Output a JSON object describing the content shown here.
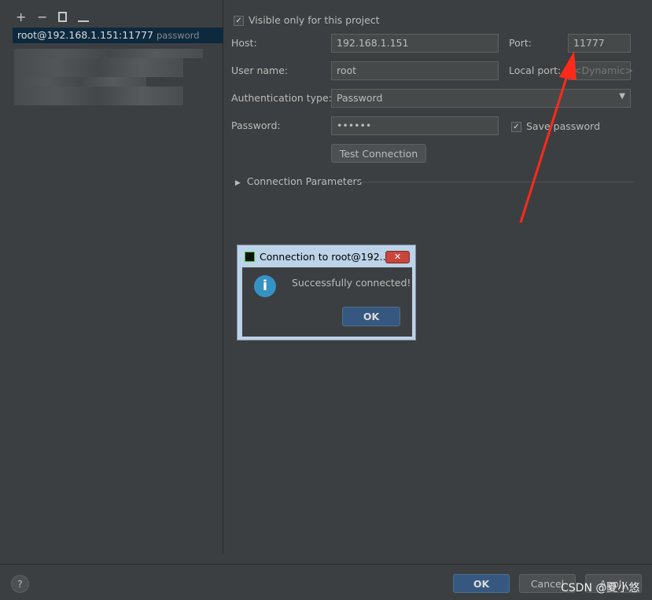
{
  "toolbar": {
    "add": "+",
    "remove": "−",
    "icons": [
      "plus-icon",
      "minus-icon",
      "copy-icon",
      "edit-icon"
    ]
  },
  "list": {
    "selected_name": "root@192.168.1.151:11777",
    "selected_type": "password"
  },
  "form": {
    "visible_only": "Visible only for this project",
    "host_label": "Host:",
    "host_value": "192.168.1.151",
    "port_label": "Port:",
    "port_value": "11777",
    "user_label": "User name:",
    "user_value": "root",
    "local_port_label": "Local port:",
    "local_port_placeholder": "<Dynamic>",
    "auth_label": "Authentication type:",
    "auth_value": "Password",
    "password_label": "Password:",
    "password_value": "••••••",
    "save_password": "Save password",
    "test_connection": "Test Connection",
    "connection_params": "Connection Parameters"
  },
  "dialog": {
    "title": "Connection to root@192....",
    "message": "Successfully connected!",
    "ok": "OK"
  },
  "footer": {
    "help": "?",
    "ok": "OK",
    "cancel": "Cancel",
    "apply": "Apply"
  },
  "watermark": "CSDN @夏小悠",
  "colors": {
    "accent": "#365880",
    "arrow": "#ff2a1a",
    "selection": "#0d293e"
  }
}
